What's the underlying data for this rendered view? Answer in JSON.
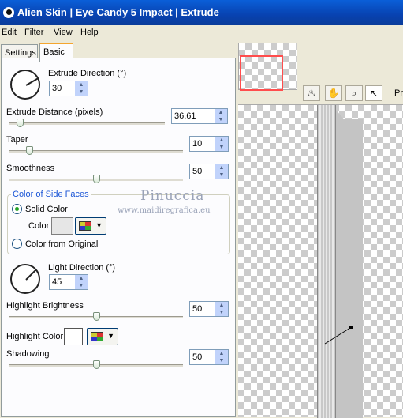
{
  "window": {
    "title": "Alien Skin  |  Eye Candy 5 Impact  |  Extrude"
  },
  "menu": [
    "Edit",
    "Filter",
    "View",
    "Help"
  ],
  "tabs": [
    {
      "label": "Settings"
    },
    {
      "label": "Basic"
    }
  ],
  "extrude_direction": {
    "label": "Extrude Direction (°)",
    "value": "30"
  },
  "extrude_distance": {
    "label": "Extrude Distance (pixels)",
    "value": "36.61",
    "slider_fraction": 0.05
  },
  "taper": {
    "label": "Taper",
    "value": "10",
    "slider_fraction": 0.1
  },
  "smoothness": {
    "label": "Smoothness",
    "value": "50",
    "slider_fraction": 0.5
  },
  "side_faces": {
    "group_label": "Color of Side Faces",
    "solid_color_label": "Solid Color",
    "color_label": "Color",
    "color_value": "#e6e6e6",
    "from_original_label": "Color from Original",
    "selected": "solid"
  },
  "watermark": {
    "name": "Pinuccia",
    "url": "www.maidiregrafica.eu"
  },
  "light_direction": {
    "label": "Light Direction (°)",
    "value": "45"
  },
  "highlight_brightness": {
    "label": "Highlight Brightness",
    "value": "50",
    "slider_fraction": 0.5
  },
  "highlight_color": {
    "label": "Highlight Color",
    "value": "#ffffff"
  },
  "shadowing": {
    "label": "Shadowing",
    "value": "50",
    "slider_fraction": 0.5
  },
  "preview": {
    "toolbar_trailing_text": "Pr",
    "tools": [
      "preview-toggle-icon",
      "hand-icon",
      "zoom-icon",
      "pointer-icon"
    ]
  },
  "colors": {
    "title_bar": "#0842b0",
    "group_label": "#1a55d6",
    "nav_frame": "#ff4d4d"
  }
}
